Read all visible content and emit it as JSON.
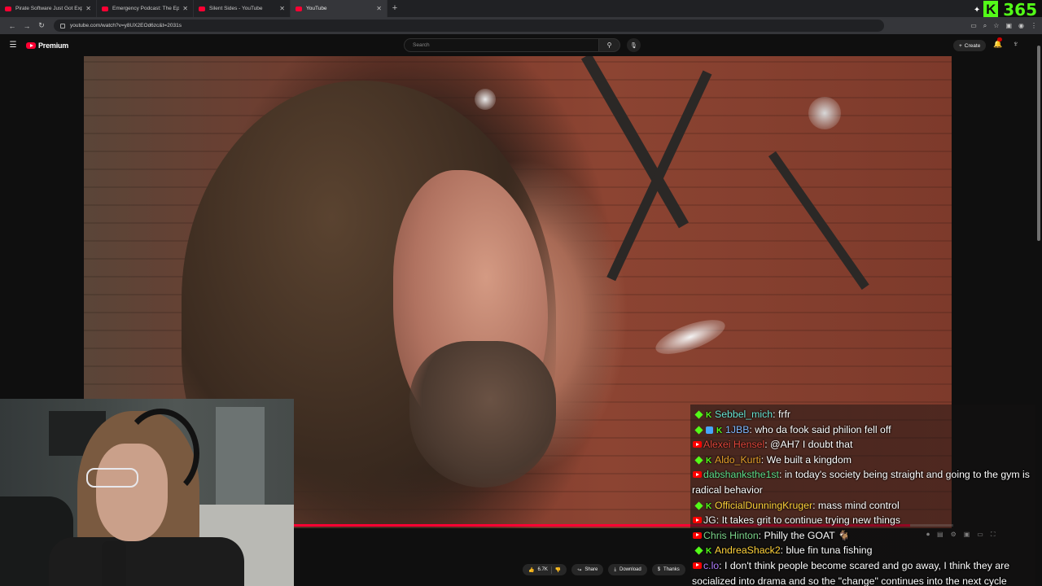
{
  "browser": {
    "tabs": [
      {
        "title": "Pirate Software Just Got Expose",
        "active": false
      },
      {
        "title": "Emergency Podcast: The Epstein",
        "active": false
      },
      {
        "title": "Silent Sides - YouTube",
        "active": false
      },
      {
        "title": "YouTube",
        "active": true
      }
    ],
    "url": "youtube.com/watch?v=y8UX2EOd6zc&t=2031s",
    "overlay_brand": "365"
  },
  "youtube": {
    "logo_text": "Premium",
    "search_placeholder": "Search",
    "create_label": "Create"
  },
  "player": {
    "progress_fraction": 0.935,
    "actions": {
      "likes": "6.7K",
      "share_label": "Share",
      "download_label": "Download",
      "thanks_label": "Thanks"
    }
  },
  "chat": {
    "colors": {
      "kick_green": "#53fc18",
      "yt_red": "#ff0000"
    },
    "messages": [
      {
        "platform": "kick",
        "extra_badge": "kick",
        "user": "Sebbel_mich",
        "color": "#6be5d3",
        "text": "frfr"
      },
      {
        "platform": "kick",
        "extra_badge": "cube",
        "user": "1JBB",
        "color": "#7fb8ff",
        "text": "who da fook said philion fell off"
      },
      {
        "platform": "youtube",
        "extra_badge": "",
        "user": "Alexei Hensel",
        "color": "#e0463a",
        "text": "@AH7 I doubt that"
      },
      {
        "platform": "kick",
        "extra_badge": "kick",
        "user": "Aldo_Kurti",
        "color": "#e6a02a",
        "text": "We built a kingdom"
      },
      {
        "platform": "youtube",
        "extra_badge": "",
        "user": "dabshanksthe1st",
        "color": "#5fe08a",
        "text": "in today's society being straight and going to the gym is radical behavior"
      },
      {
        "platform": "kick",
        "extra_badge": "kick",
        "user": "OfficialDunningKruger",
        "color": "#ffd23a",
        "text": "mass mind control"
      },
      {
        "platform": "youtube",
        "extra_badge": "",
        "user": "JG",
        "color": "#f2f2f2",
        "text": "It takes grit to continue trying new things"
      },
      {
        "platform": "youtube",
        "extra_badge": "",
        "user": "Chris Hinton",
        "color": "#7bd48a",
        "text": "Philly the GOAT 🐐"
      },
      {
        "platform": "kick",
        "extra_badge": "kick",
        "user": "AndreaShack2",
        "color": "#ffd23a",
        "text": "blue fin tuna fishing"
      },
      {
        "platform": "youtube",
        "extra_badge": "",
        "user": "c.lo",
        "color": "#b07cff",
        "text": "I don't think people become scared and go away, I think they are socialized into drama and so the \"change\" continues into the next cycle"
      }
    ]
  }
}
